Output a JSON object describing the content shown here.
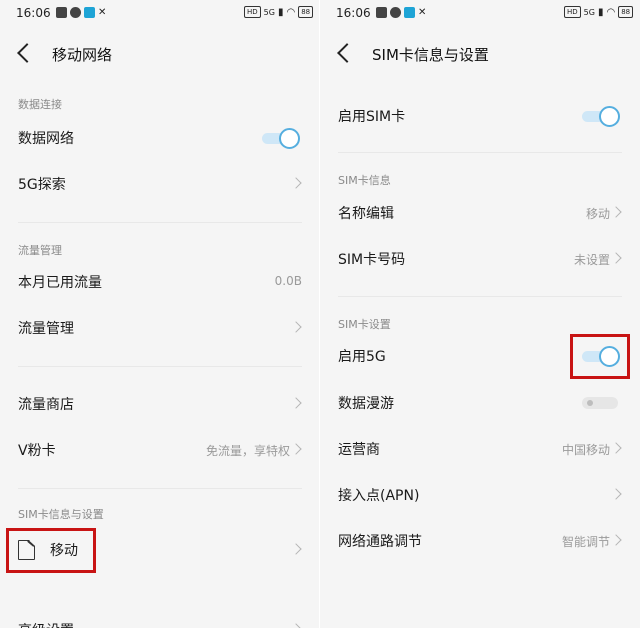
{
  "left": {
    "status": {
      "time": "16:06",
      "sig": "5G"
    },
    "title": "移动网络",
    "sections": {
      "data_conn": "数据连接",
      "traffic": "流量管理",
      "sim": "SIM卡信息与设置"
    },
    "rows": {
      "data_network": "数据网络",
      "explore_5g": "5G探索",
      "monthly_used": "本月已用流量",
      "monthly_used_value": "0.0B",
      "traffic_mgmt": "流量管理",
      "traffic_store": "流量商店",
      "vcard": "V粉卡",
      "vcard_value": "免流量，享特权",
      "sim_mobile": "移动",
      "advanced": "高级设置"
    }
  },
  "right": {
    "status": {
      "time": "16:06",
      "sig": "5G"
    },
    "title": "SIM卡信息与设置",
    "sections": {
      "sim_info": "SIM卡信息",
      "sim_settings": "SIM卡设置"
    },
    "rows": {
      "enable_sim": "启用SIM卡",
      "name_edit": "名称编辑",
      "name_edit_value": "移动",
      "sim_number": "SIM卡号码",
      "sim_number_value": "未设置",
      "enable_5g": "启用5G",
      "data_roaming": "数据漫游",
      "carrier": "运营商",
      "carrier_value": "中国移动",
      "apn": "接入点(APN)",
      "net_channel": "网络通路调节",
      "net_channel_value": "智能调节"
    }
  },
  "colors": {
    "accent": "#55aedf",
    "highlight": "#c81414"
  }
}
